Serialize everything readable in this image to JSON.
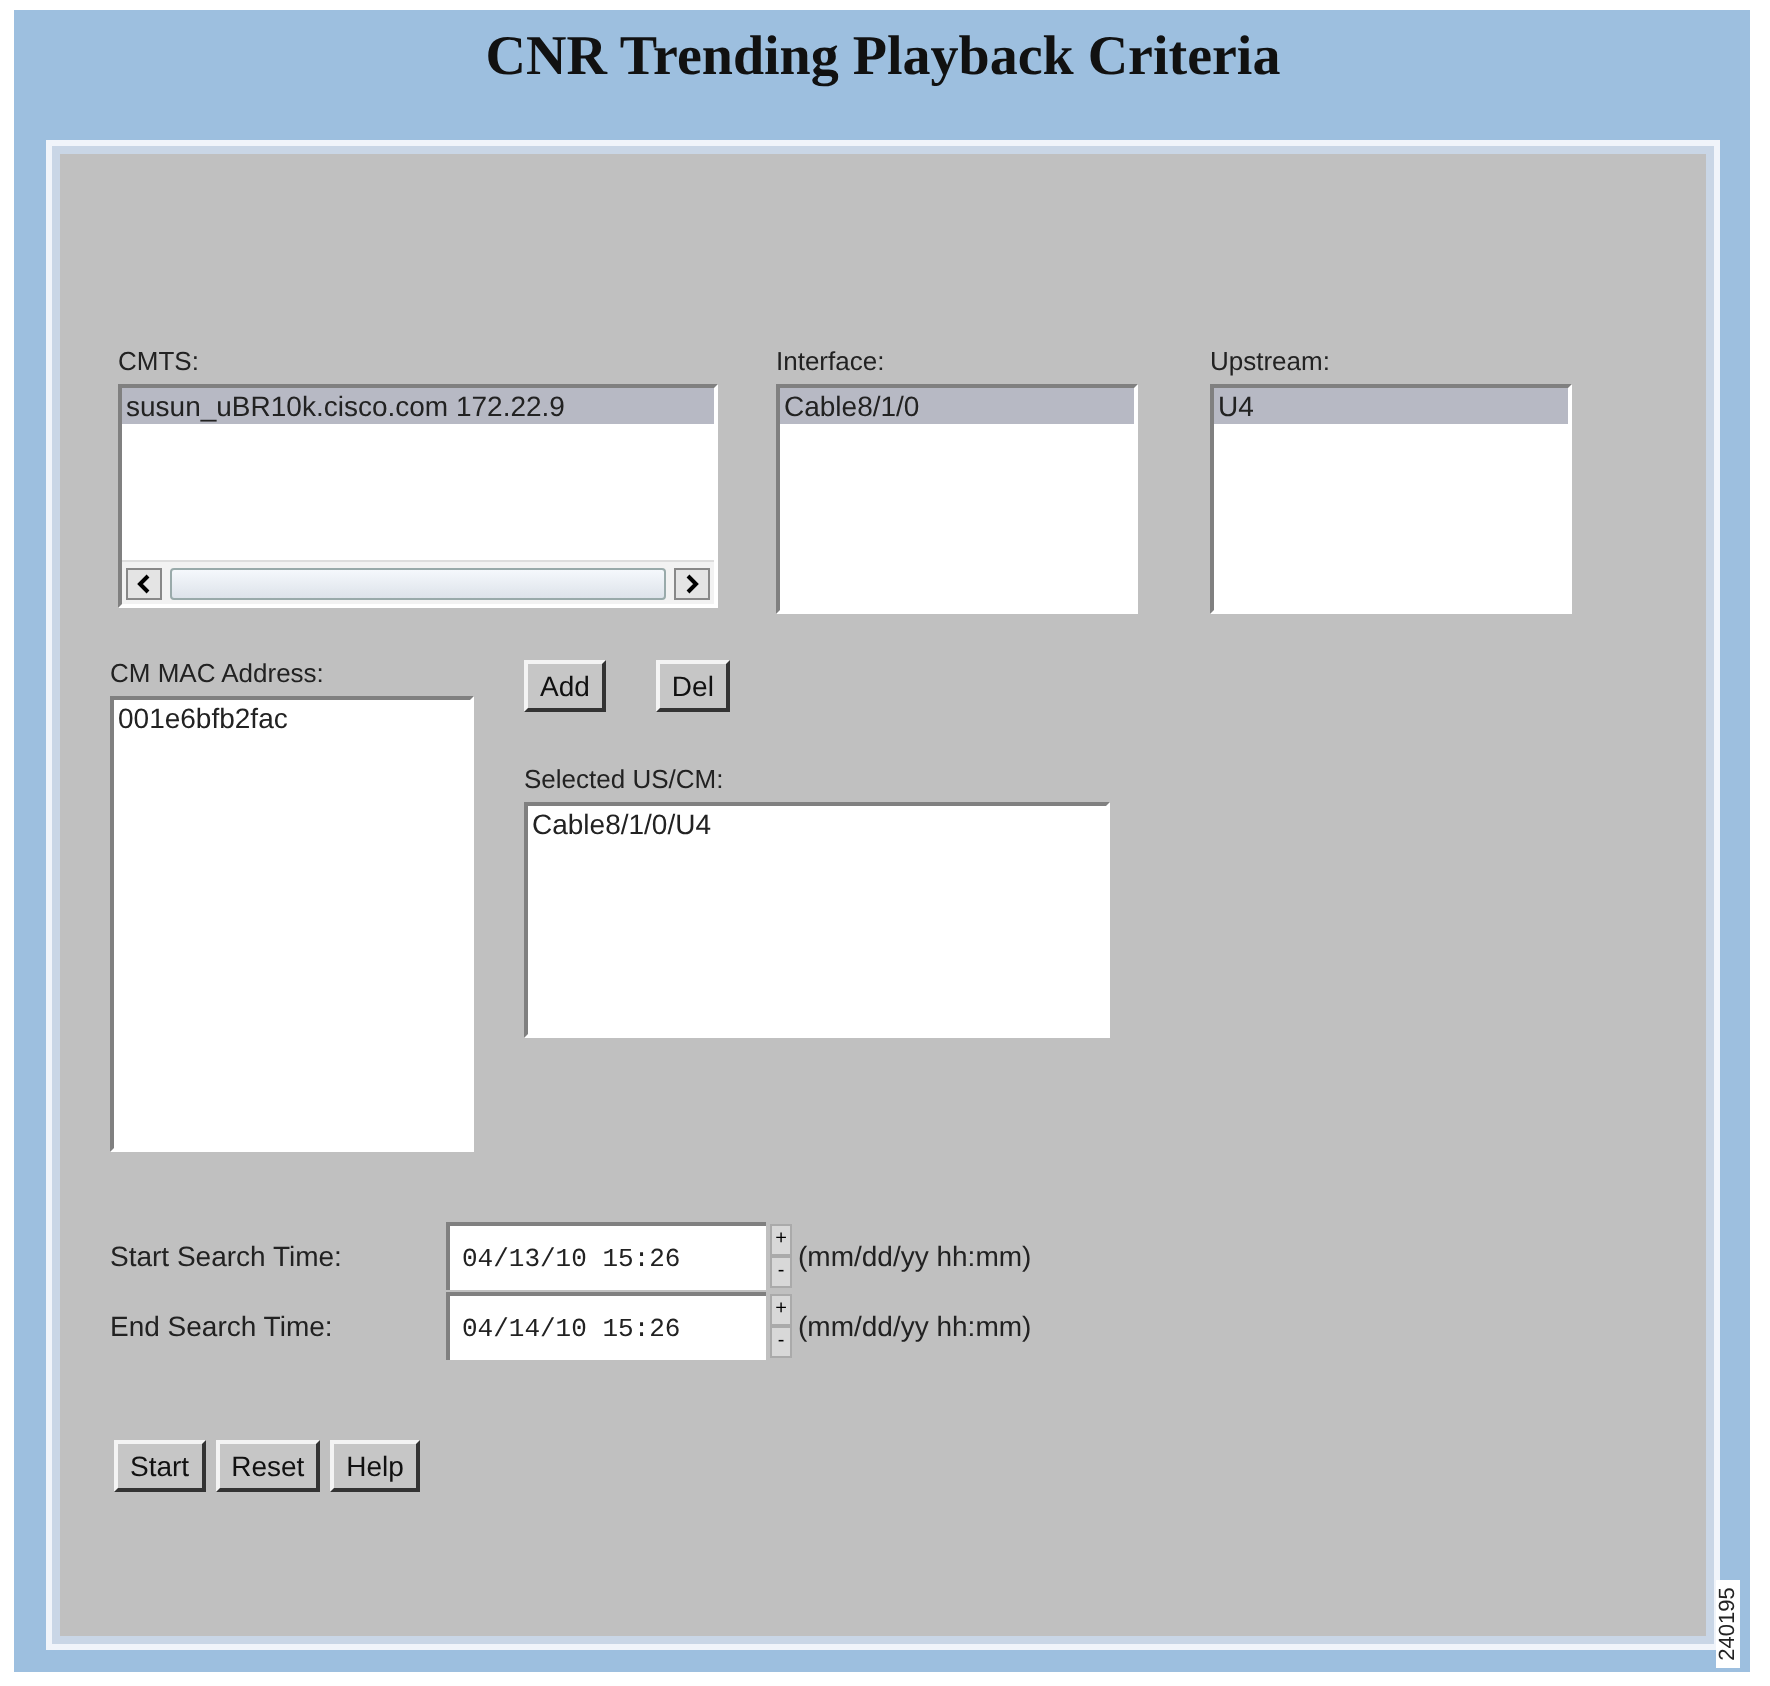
{
  "title": "CNR Trending Playback Criteria",
  "cmts": {
    "label": "CMTS:",
    "items": [
      {
        "text": "susun_uBR10k.cisco.com 172.22.9",
        "selected": true
      }
    ]
  },
  "interface": {
    "label": "Interface:",
    "items": [
      {
        "text": "Cable8/1/0",
        "selected": true
      }
    ]
  },
  "upstream": {
    "label": "Upstream:",
    "items": [
      {
        "text": "U4",
        "selected": true
      }
    ]
  },
  "cm_mac": {
    "label": "CM MAC Address:",
    "items": [
      {
        "text": "001e6bfb2fac",
        "selected": false
      }
    ]
  },
  "list_buttons": [
    "Add",
    "Del"
  ],
  "selected_us_cm": {
    "label": "Selected US/CM:",
    "items": [
      {
        "text": "Cable8/1/0/U4",
        "selected": false
      }
    ]
  },
  "times": [
    {
      "label": "Start Search Time:",
      "value": "04/13/10 15:26",
      "up": "+",
      "down": "-",
      "format": "(mm/dd/yy hh:mm)"
    },
    {
      "label": "End Search Time:",
      "value": "04/14/10 15:26",
      "up": "+",
      "down": "-",
      "format": "(mm/dd/yy hh:mm)"
    }
  ],
  "buttons": [
    "Start",
    "Reset",
    "Help"
  ],
  "figure_number": "240195"
}
